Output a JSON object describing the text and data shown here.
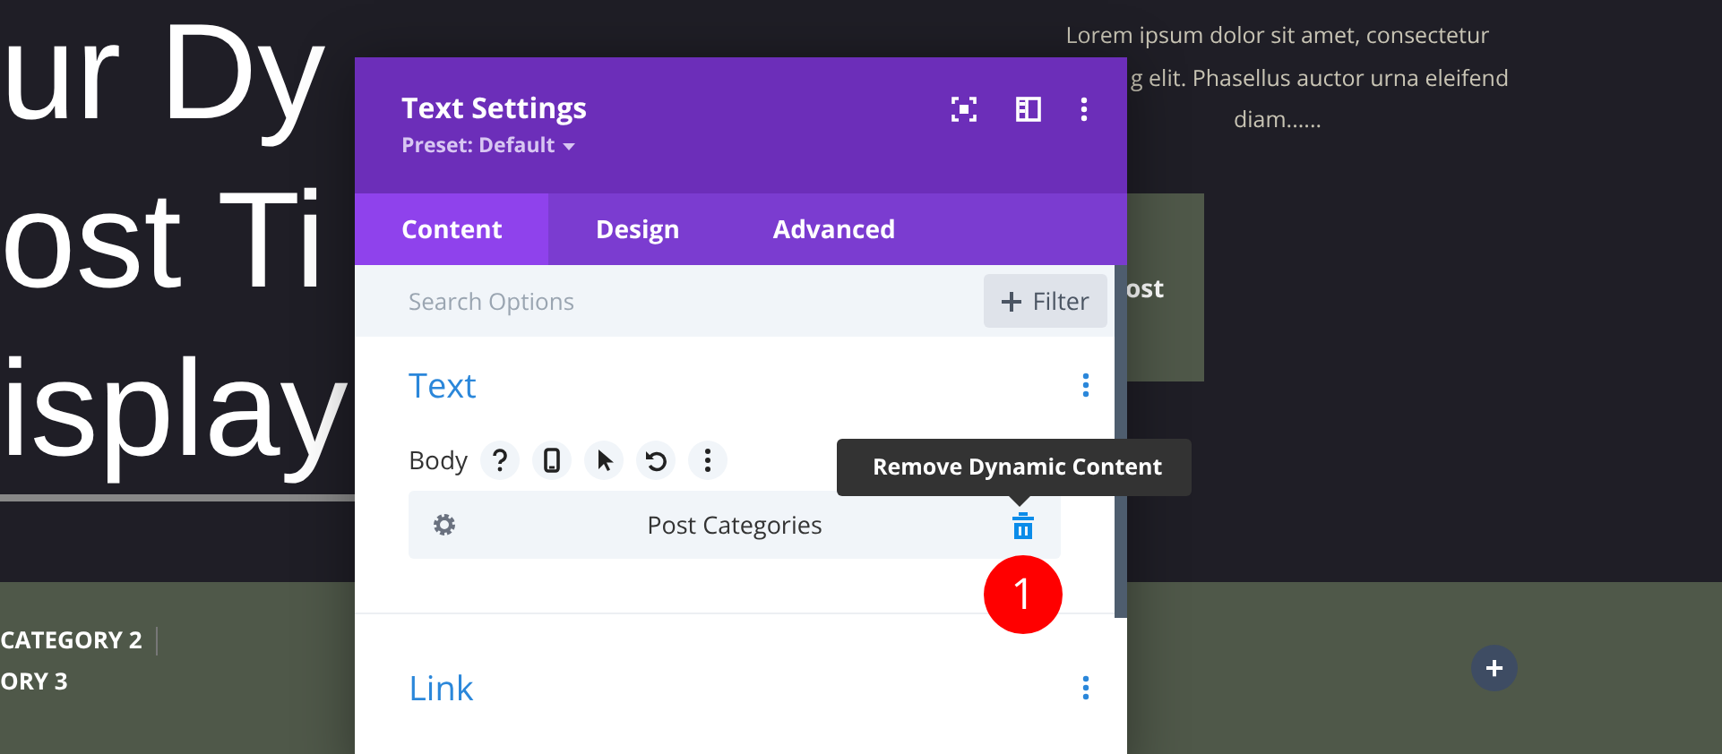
{
  "page_background": {
    "title_lines": [
      "ur Dy",
      "ost Ti",
      "isplay"
    ],
    "excerpt_lines": [
      "Lorem ipsum dolor sit amet, consectetur",
      "g elit. Phasellus auctor urna eleifend",
      "diam......"
    ],
    "card_text": "ost",
    "category_lines": [
      "CATEGORY 2",
      "ORY 3"
    ],
    "add_button": "+"
  },
  "modal": {
    "title": "Text Settings",
    "preset": "Preset: Default",
    "tabs": [
      {
        "label": "Content",
        "selected": true
      },
      {
        "label": "Design",
        "selected": false
      },
      {
        "label": "Advanced",
        "selected": false
      }
    ],
    "search": {
      "placeholder": "Search Options"
    },
    "filter_button": "Filter",
    "sections": [
      {
        "title": "Text",
        "field_label": "Body",
        "dynamic_value": "Post Categories"
      },
      {
        "title": "Link"
      }
    ]
  },
  "tooltip": "Remove Dynamic Content",
  "step_badge": "1"
}
